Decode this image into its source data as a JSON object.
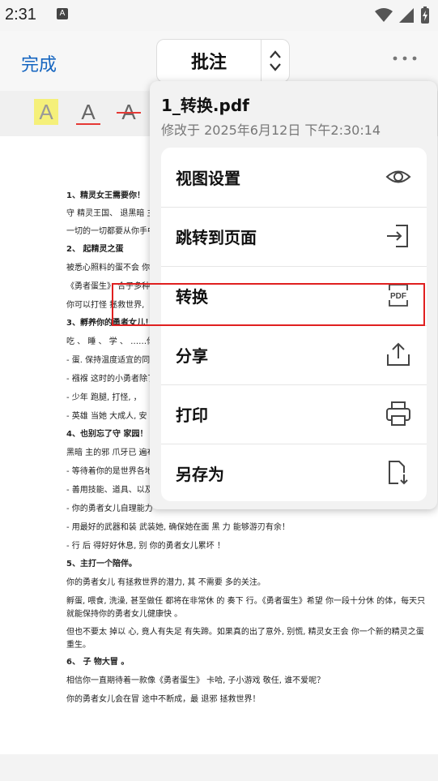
{
  "status_bar": {
    "time": "2:31",
    "notification_letter": "A"
  },
  "toolbar": {
    "done_label": "完成",
    "mode_label": "批注"
  },
  "format_bar": {
    "highlight_glyph": "A",
    "underline_glyph": "A",
    "strike_glyph": "A"
  },
  "document": {
    "lines": [
      "1、精灵女王需要你！",
      "守 精灵王国、 退黑暗 主",
      "一切的一切都要从你手中",
      "2、 起精灵之蛋",
      "被悉心照料的蛋不会 你",
      "《勇者蛋生》 合子多种",
      "你可以打怪  拯救世界,",
      "3、孵养你的勇者女儿！",
      "吃 、 睡 、 学 、 ……你得",
      "- 蛋. 保持温度适宜的同",
      "- 襁褓 这时的小勇者除了",
      "- 少年 跑腿,  打怪,   ，",
      "- 英雄 当她 大成人,  安",
      "4、也别忘了守 家园！",
      "黑暗 主的邪 爪牙已 遍布",
      "- 等待着你的是世界各地",
      "- 善用技能、道具、以及",
      "- 你的勇者女儿自理能力",
      "- 用最好的武器和装 武装她,  确保她在面 黑  力 能够游刃有余！",
      "- 行  后 得好好休息,  别 你的勇者女儿累坏  ！",
      "5、主打一个陪伴。",
      "你的勇者女儿 有拯救世界的潜力,  其 不需要 多的关注。",
      "孵蛋,  喂食,  洗澡,  甚至做任 都将在非常休 的 奏下 行。《勇者蛋生》希望  你一段十分休 的体，每天只",
      "就能保持你的勇者女儿健康快 。",
      "但也不要太 掉以 心,   竟人有失足 有失蹄。如果真的出了意外,  别慌,  精灵女王会 你一个新的精灵之蛋",
      "重生。",
      "6、 子 物大冒 。",
      "相信你一直期待着一款像《勇者蛋生》 卡哈, 子小游戏  敬任, 谁不爱呢？",
      "你的勇者女儿会在冒 途中不断成，最  退邪 拯救世界！"
    ]
  },
  "menu": {
    "file_name": "1_转换.pdf",
    "file_meta": "修改于 2025年6月12日 下午2:30:14",
    "items": [
      {
        "label": "视图设置",
        "icon": "eye-icon"
      },
      {
        "label": "跳转到页面",
        "icon": "go-to-page-icon"
      },
      {
        "label": "转换",
        "icon": "pdf-convert-icon"
      },
      {
        "label": "分享",
        "icon": "share-icon"
      },
      {
        "label": "打印",
        "icon": "print-icon"
      },
      {
        "label": "另存为",
        "icon": "save-as-icon"
      }
    ],
    "pdf_icon_text": "PDF"
  },
  "colors": {
    "accent": "#1565c0",
    "highlight_box": "#e02020",
    "format_highlight": "#f5f07a",
    "format_red": "#e53935"
  }
}
